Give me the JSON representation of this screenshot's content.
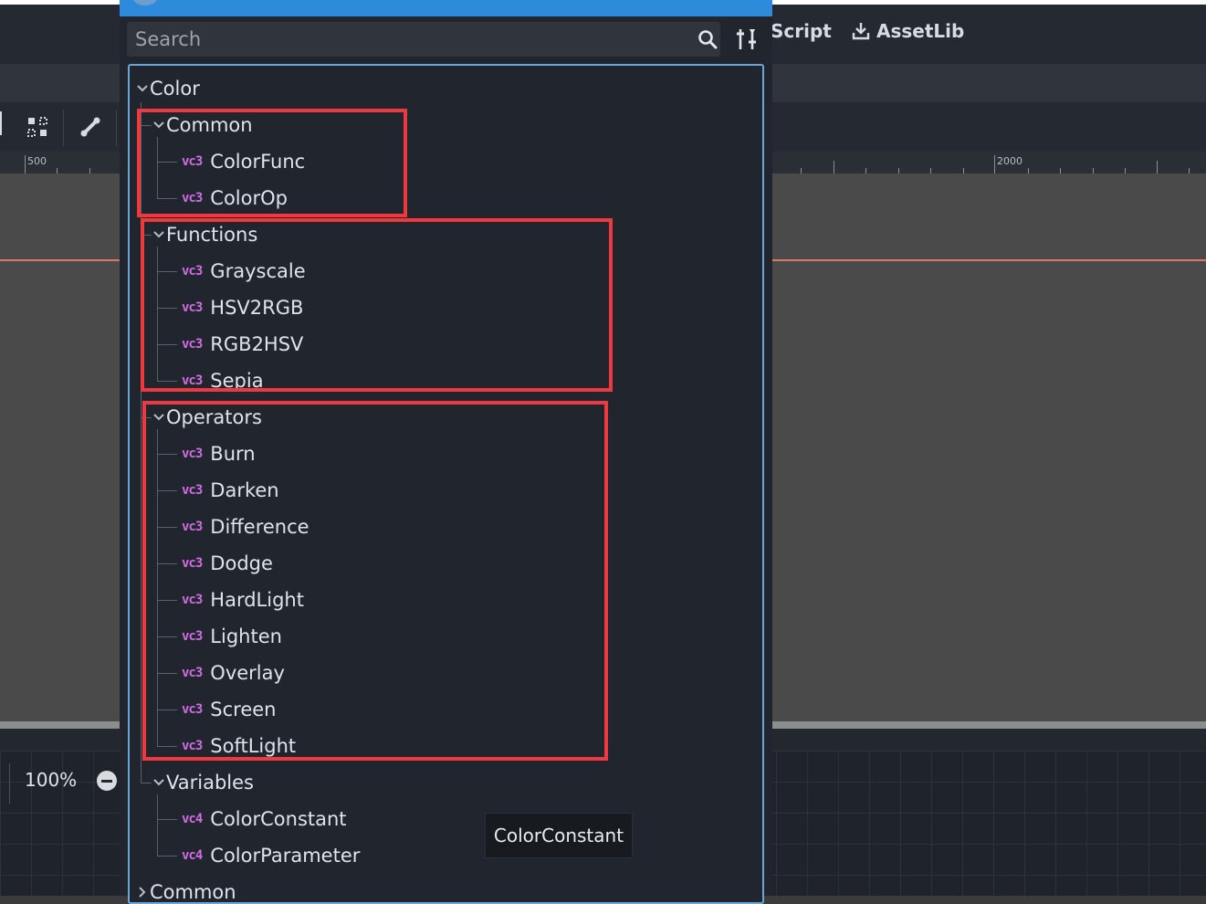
{
  "editor": {
    "tab_script": "Script",
    "tab_assetlib": "AssetLib",
    "ruler_left": "500",
    "ruler_right": "2000",
    "zoom_level": "100%"
  },
  "dialog": {
    "search": {
      "placeholder": "Search",
      "value": ""
    },
    "tree": {
      "root": "Color",
      "common": {
        "label": "Common",
        "items": [
          "ColorFunc",
          "ColorOp"
        ]
      },
      "functions": {
        "label": "Functions",
        "items": [
          "Grayscale",
          "HSV2RGB",
          "RGB2HSV",
          "Sepia"
        ]
      },
      "operators": {
        "label": "Operators",
        "items": [
          "Burn",
          "Darken",
          "Difference",
          "Dodge",
          "HardLight",
          "Lighten",
          "Overlay",
          "Screen",
          "SoftLight"
        ]
      },
      "variables": {
        "label": "Variables",
        "items": [
          "ColorConstant",
          "ColorParameter"
        ]
      },
      "next_root": "Common"
    },
    "tooltip": "ColorConstant"
  },
  "icons": {
    "vector3": "vector3-icon",
    "vector4": "vector4-icon",
    "vector3_glyph": "vc3",
    "vector4_glyph": "vc4"
  },
  "colors": {
    "accent": "#2e8bdb",
    "highlight_border": "#ee3a3f",
    "icon_pink": "#d26be3",
    "panel_bg": "#21262e"
  }
}
